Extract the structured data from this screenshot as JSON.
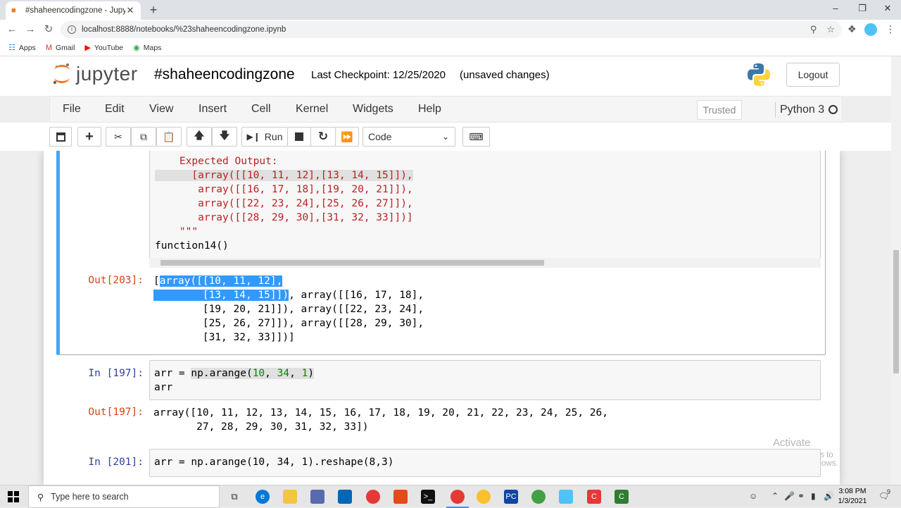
{
  "browser": {
    "tab_title": "#shaheencodingzone - Jupyter N",
    "url": "localhost:8888/notebooks/%23shaheencodingzone.ipynb",
    "bookmarks": [
      {
        "label": "Apps",
        "icon": "apps-grid-icon"
      },
      {
        "label": "Gmail",
        "icon": "gmail-icon"
      },
      {
        "label": "YouTube",
        "icon": "youtube-icon"
      },
      {
        "label": "Maps",
        "icon": "maps-icon"
      }
    ]
  },
  "header": {
    "logo_text": "jupyter",
    "notebook_name": "#shaheencodingzone",
    "checkpoint": "Last Checkpoint: 12/25/2020",
    "unsaved": "(unsaved changes)",
    "logout": "Logout"
  },
  "menu": {
    "items": [
      "File",
      "Edit",
      "View",
      "Insert",
      "Cell",
      "Kernel",
      "Widgets",
      "Help"
    ],
    "trusted": "Trusted",
    "kernel": "Python 3"
  },
  "toolbar": {
    "run_label": "Run",
    "cell_type": "Code"
  },
  "cells": {
    "c1": {
      "lines": [
        "    Expected Output:",
        "      [array([[10, 11, 12],[13, 14, 15]]),",
        "       array([[16, 17, 18],[19, 20, 21]]),",
        "       array([[22, 23, 24],[25, 26, 27]]),",
        "       array([[28, 29, 30],[31, 32, 33]])]",
        "    \"\"\"",
        "function14()"
      ],
      "out_prompt": "Out[203]:",
      "out_sel_1": "array([[10, 11, 12],",
      "out_sel_2": "[13, 14, 15]])",
      "out_lines": [
        "[",
        "        ",
        ", array([[16, 17, 18],",
        "        [19, 20, 21]]), array([[22, 23, 24],",
        "        [25, 26, 27]]), array([[28, 29, 30],",
        "        [31, 32, 33]])]"
      ]
    },
    "c2": {
      "in_prompt": "In [197]:",
      "line1_a": "arr = ",
      "line1_b": "np.arange(",
      "line1_n1": "10",
      "line1_n2": "34",
      "line1_n3": "1",
      "line2": "arr",
      "out_prompt": "Out[197]:",
      "out1": "array([10, 11, 12, 13, 14, 15, 16, 17, 18, 19, 20, 21, 22, 23, 24, 25, 26,",
      "out2": "       27, 28, 29, 30, 31, 32, 33])"
    },
    "c3": {
      "in_prompt": "In [201]:",
      "code": "arr = np.arange(10, 34, 1).reshape(8,3)"
    }
  },
  "watermark": {
    "line1": "Activate Windows",
    "line2": "Go to Settings to activate Windows."
  },
  "taskbar": {
    "search_placeholder": "Type here to search",
    "time": "3:08 PM",
    "date": "1/3/2021",
    "notification_count": "9"
  }
}
